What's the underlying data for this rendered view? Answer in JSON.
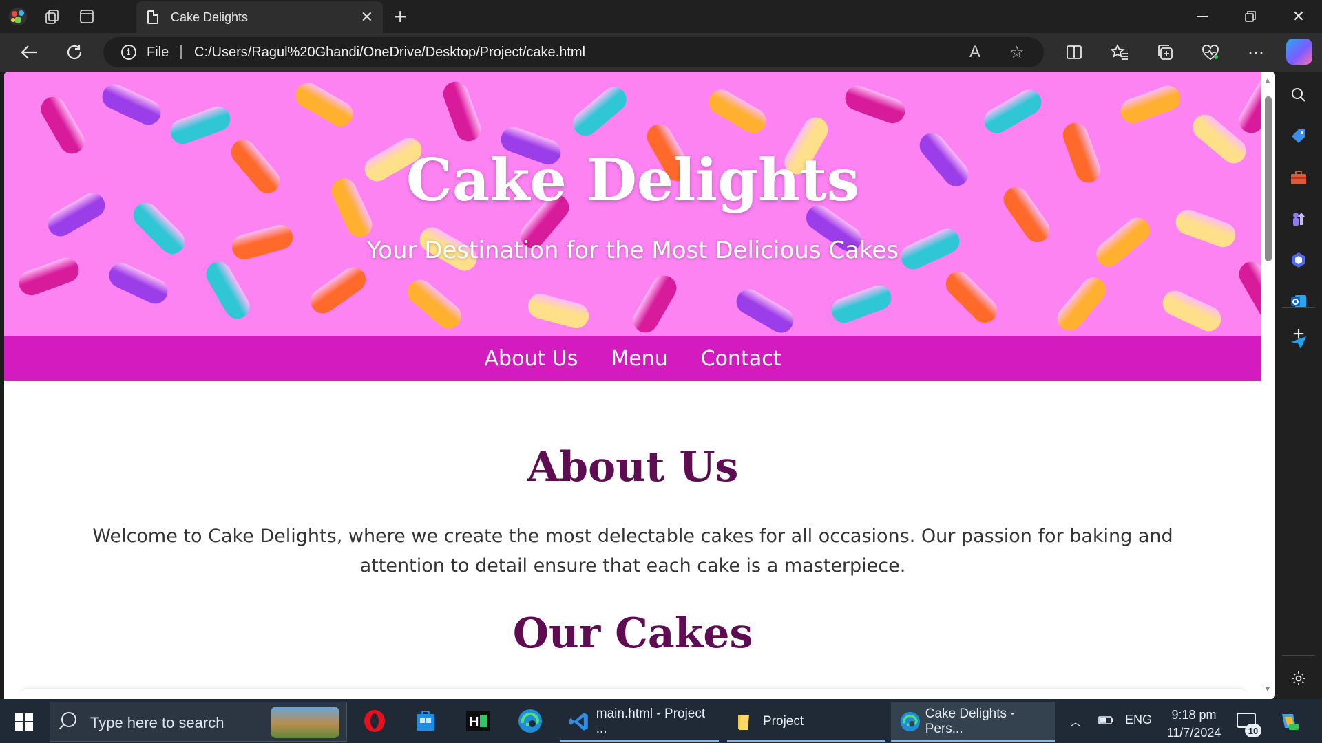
{
  "browser": {
    "tab_title": "Cake Delights",
    "file_label": "File",
    "url": "C:/Users/Ragul%20Ghandi/OneDrive/Desktop/Project/cake.html",
    "read_aloud_label": "A"
  },
  "site": {
    "hero_title": "Cake Delights",
    "hero_subtitle": "Your Destination for the Most Delicious Cakes",
    "nav": [
      {
        "label": "About Us"
      },
      {
        "label": "Menu"
      },
      {
        "label": "Contact"
      }
    ],
    "about_heading": "About Us",
    "about_text": "Welcome to Cake Delights, where we create the most delectable cakes for all occasions. Our passion for baking and attention to detail ensure that each cake is a masterpiece.",
    "cakes_heading": "Our Cakes",
    "colors": {
      "hero_bg": "#fd83f3",
      "nav_bg": "#d31bbf",
      "heading": "#5e0d52"
    }
  },
  "taskbar": {
    "search_placeholder": "Type here to search",
    "tasks": [
      {
        "label": "main.html - Project ..."
      },
      {
        "label": "Project"
      },
      {
        "label": "Cake Delights - Pers..."
      }
    ],
    "language": "ENG",
    "time": "9:18 pm",
    "date": "11/7/2024",
    "notification_count": "10"
  }
}
